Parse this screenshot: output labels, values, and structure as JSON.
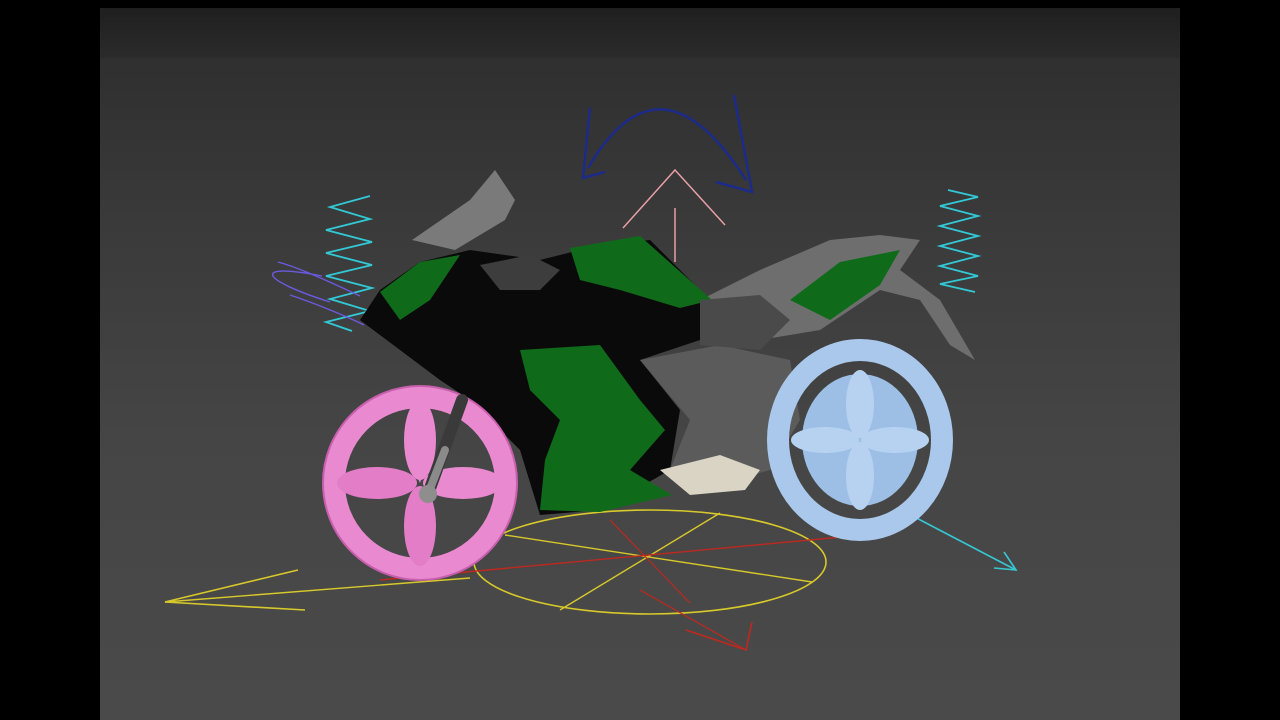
{
  "viewport": {
    "background_top": "#2b2b2b",
    "background_bottom": "#4a4a4a",
    "letterbox": "#000000"
  },
  "model": {
    "body_colors": [
      "#0f6b1a",
      "#0a0a0a",
      "#6e6e6e"
    ],
    "front_wheel_color": "#e98ad0",
    "rear_wheel_color": "#a9c8ec"
  },
  "gizmos": {
    "spring_color": "#32c9d6",
    "rotate_arc_color": "#1c2b8a",
    "ground_circle_color": "#d8c92a",
    "axis_red": "#c0281e",
    "axis_cyan": "#36c7d2",
    "pink_arrow": "#e7a0a6",
    "purple_curve": "#6a5ae0"
  }
}
